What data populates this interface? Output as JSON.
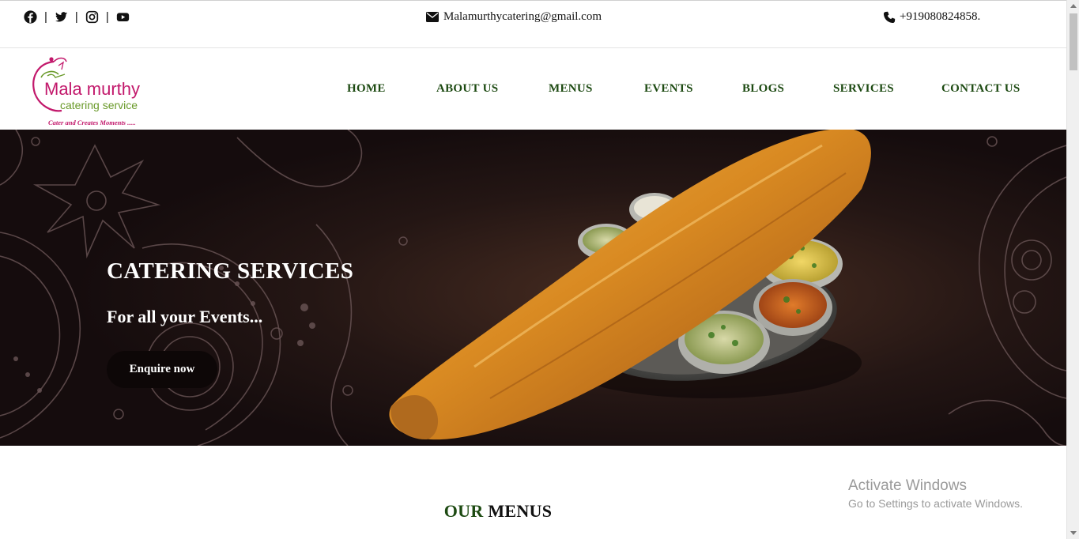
{
  "topbar": {
    "social_icons": [
      "facebook-icon",
      "twitter-icon",
      "instagram-icon",
      "youtube-icon"
    ],
    "separator": "|",
    "email": "Malamurthycatering@gmail.com",
    "phone": "+919080824858."
  },
  "logo": {
    "line1": "Mala murthy",
    "line2": "catering service",
    "tagline": "Cater and Creates Moments ....."
  },
  "nav": {
    "items": [
      {
        "label": "HOME"
      },
      {
        "label": "ABOUT US"
      },
      {
        "label": "MENUS"
      },
      {
        "label": "EVENTS"
      },
      {
        "label": "BLOGS"
      },
      {
        "label": "SERVICES"
      },
      {
        "label": "CONTACT US"
      }
    ]
  },
  "hero": {
    "title": "CATERING SERVICES",
    "subtitle": "For all your Events...",
    "button": "Enquire now"
  },
  "section": {
    "heading_green": "OUR",
    "heading_dark": "MENUS"
  },
  "watermark": {
    "title": "Activate Windows",
    "subtitle": "Go to Settings to activate Windows."
  },
  "colors": {
    "nav_green": "#1d4a12",
    "logo_pink": "#c2186b",
    "logo_green": "#6a9a2a",
    "hero_bg": "#1a0f10"
  }
}
